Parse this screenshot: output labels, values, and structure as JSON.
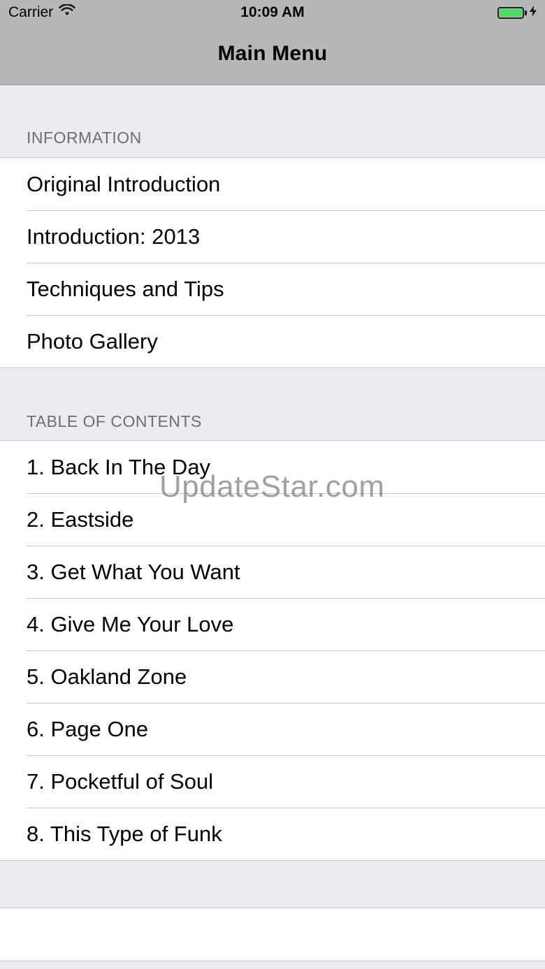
{
  "status_bar": {
    "carrier": "Carrier",
    "time": "10:09 AM",
    "wifi_icon": "wifi-icon",
    "battery_color": "#4cd964"
  },
  "nav": {
    "title": "Main Menu"
  },
  "sections": [
    {
      "header": "INFORMATION",
      "items": [
        "Original Introduction",
        "Introduction: 2013",
        "Techniques and Tips",
        "Photo Gallery"
      ]
    },
    {
      "header": "TABLE OF CONTENTS",
      "items": [
        "1.  Back In The Day",
        "2.  Eastside",
        "3.  Get What You Want",
        "4.  Give Me Your Love",
        "5.  Oakland Zone",
        "6.  Page One",
        "7.  Pocketful of Soul",
        "8.  This Type of Funk"
      ]
    }
  ],
  "watermark": "UpdateStar.com"
}
